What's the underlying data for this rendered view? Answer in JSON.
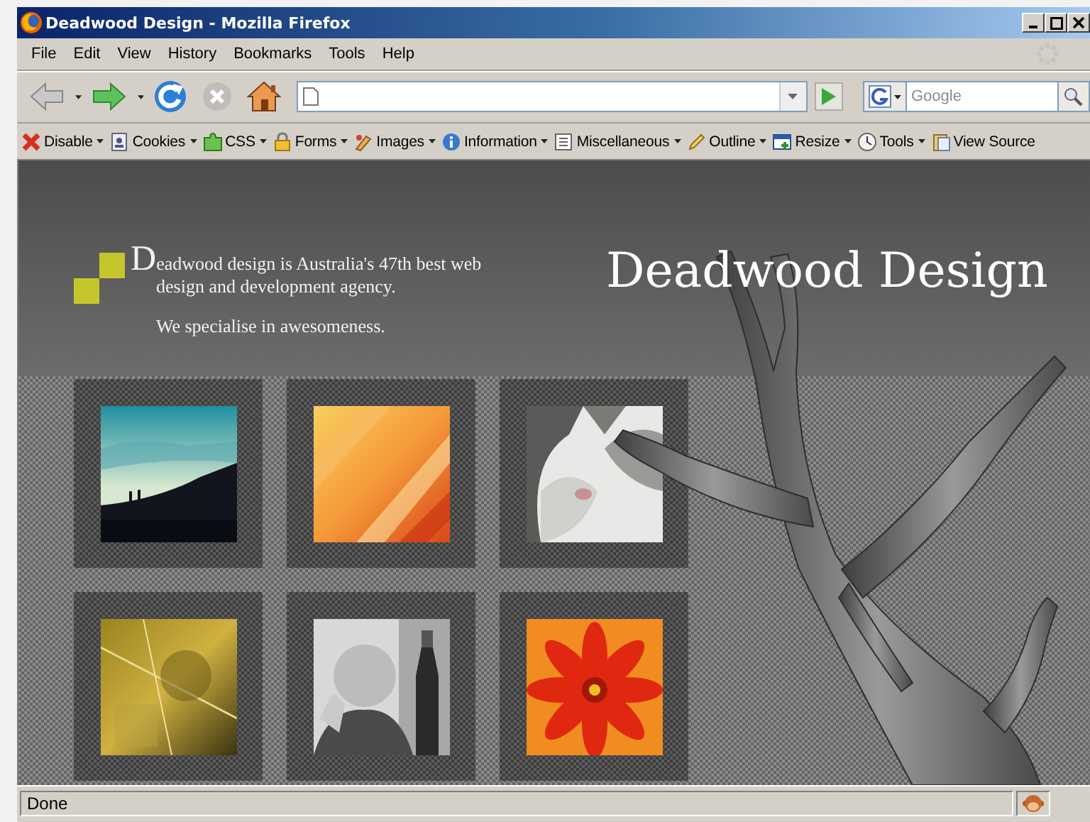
{
  "window": {
    "title": "Deadwood Design - Mozilla Firefox"
  },
  "menu": [
    "File",
    "Edit",
    "View",
    "History",
    "Bookmarks",
    "Tools",
    "Help"
  ],
  "navigation": {
    "buttons": [
      {
        "kind": "back",
        "disabled": true
      },
      {
        "kind": "forward",
        "disabled": false
      },
      {
        "kind": "reload",
        "disabled": false
      },
      {
        "kind": "stop",
        "disabled": true
      },
      {
        "kind": "home",
        "disabled": false
      }
    ],
    "search": {
      "placeholder": "Google"
    }
  },
  "bookmarks_toolbar": [
    {
      "label": "Disable",
      "dropdown": true
    },
    {
      "label": "Cookies",
      "dropdown": true
    },
    {
      "label": "CSS",
      "dropdown": true
    },
    {
      "label": "Forms",
      "dropdown": true
    },
    {
      "label": "Images",
      "dropdown": true
    },
    {
      "label": "Information",
      "dropdown": true
    },
    {
      "label": "Miscellaneous",
      "dropdown": true
    },
    {
      "label": "Outline",
      "dropdown": true
    },
    {
      "label": "Resize",
      "dropdown": true
    },
    {
      "label": "Tools",
      "dropdown": true
    },
    {
      "label": "View Source",
      "dropdown": false
    }
  ],
  "page": {
    "intro": "Deadwood design is Australia's 47th best web design and development agency.",
    "tagline": "We specialise in awesomeness.",
    "heading": "Deadwood Design"
  },
  "status_bar": {
    "text": "Done"
  }
}
